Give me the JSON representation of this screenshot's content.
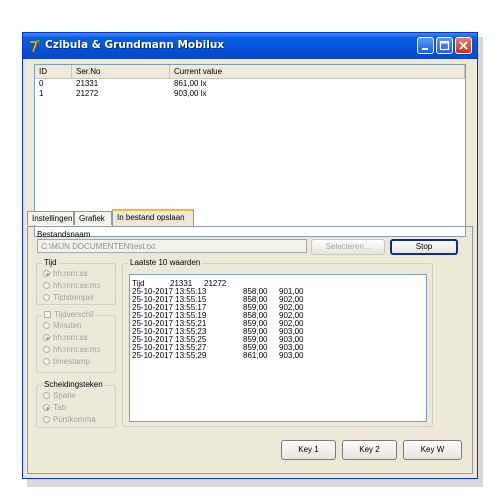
{
  "window": {
    "title": "Czibula & Grundmann Mobilux"
  },
  "icons": {
    "app": "c-g-logo-icon",
    "minimize": "minimize-icon",
    "maximize": "maximize-icon",
    "close": "close-icon"
  },
  "list": {
    "headers": [
      "ID",
      "Ser.No",
      "Current value"
    ],
    "rows": [
      [
        "0",
        "21331",
        "861,00 lx"
      ],
      [
        "1",
        "21272",
        "903,00 lx"
      ]
    ]
  },
  "tabs": [
    "Instellingen",
    "Grafiek",
    "In bestand opslaan"
  ],
  "active_tab": 2,
  "file": {
    "label": "Bestandsnaam",
    "path": "C:\\MIJN DOCUMENTEN\\test.txt",
    "select_button": "Selecteren...",
    "stop_button": "Stop"
  },
  "tijd": {
    "title": "Tijd",
    "options": [
      "hh:mm:ss",
      "hh:mm:ss:ms",
      "Tijdstempel"
    ],
    "selected": 0
  },
  "tijdverschil": {
    "title": "Tijdverschil",
    "options": [
      "Minuten",
      "hh:mm:ss",
      "hh:mm:ss:ms",
      "timestamp"
    ],
    "selected": 1
  },
  "scheidingsteken": {
    "title": "Scheidingsteken",
    "options": [
      "Spatie",
      "Tab",
      "Puntkomma"
    ],
    "selected": 1
  },
  "log": {
    "title": "Laatste 10 waarden",
    "header": [
      "Tijd",
      "21331",
      "21272"
    ],
    "lines": [
      [
        "25-10-2017 13:55:13",
        "858,00",
        "901,00"
      ],
      [
        "25-10-2017 13:55:15",
        "858,00",
        "902,00"
      ],
      [
        "25-10-2017 13:55:17",
        "859,00",
        "902,00"
      ],
      [
        "25-10-2017 13:55:19",
        "858,00",
        "902,00"
      ],
      [
        "25-10-2017 13:55:21",
        "859,00",
        "902,00"
      ],
      [
        "25-10-2017 13:55:23",
        "859,00",
        "903,00"
      ],
      [
        "25-10-2017 13:55:25",
        "859,00",
        "903,00"
      ],
      [
        "25-10-2017 13:55:27",
        "859,00",
        "903,00"
      ],
      [
        "25-10-2017 13:55:29",
        "861,00",
        "903,00"
      ]
    ]
  },
  "keys": [
    "Key 1",
    "Key 2",
    "Key W"
  ]
}
